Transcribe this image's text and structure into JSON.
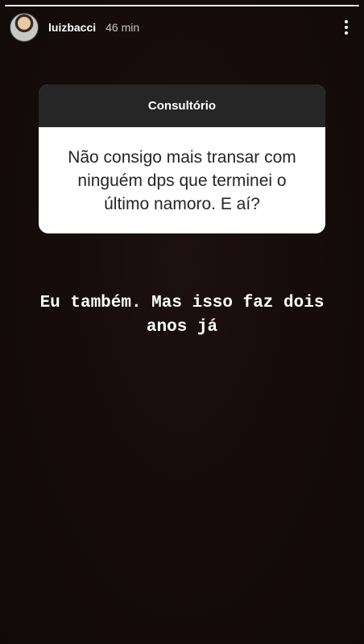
{
  "header": {
    "username": "luizbacci",
    "time": "46 min",
    "avatar_icon": "profile-photo",
    "more_icon": "more-vertical-icon"
  },
  "question_sticker": {
    "title": "Consultório",
    "question": "Não consigo mais transar com ninguém dps que terminei o último namoro. E aí?"
  },
  "reply": {
    "text": "Eu também. Mas isso faz dois anos já"
  },
  "colors": {
    "background": "#140c0c",
    "sticker_header": "#262626",
    "sticker_body": "#ffffff",
    "text_light": "#ffffff"
  }
}
